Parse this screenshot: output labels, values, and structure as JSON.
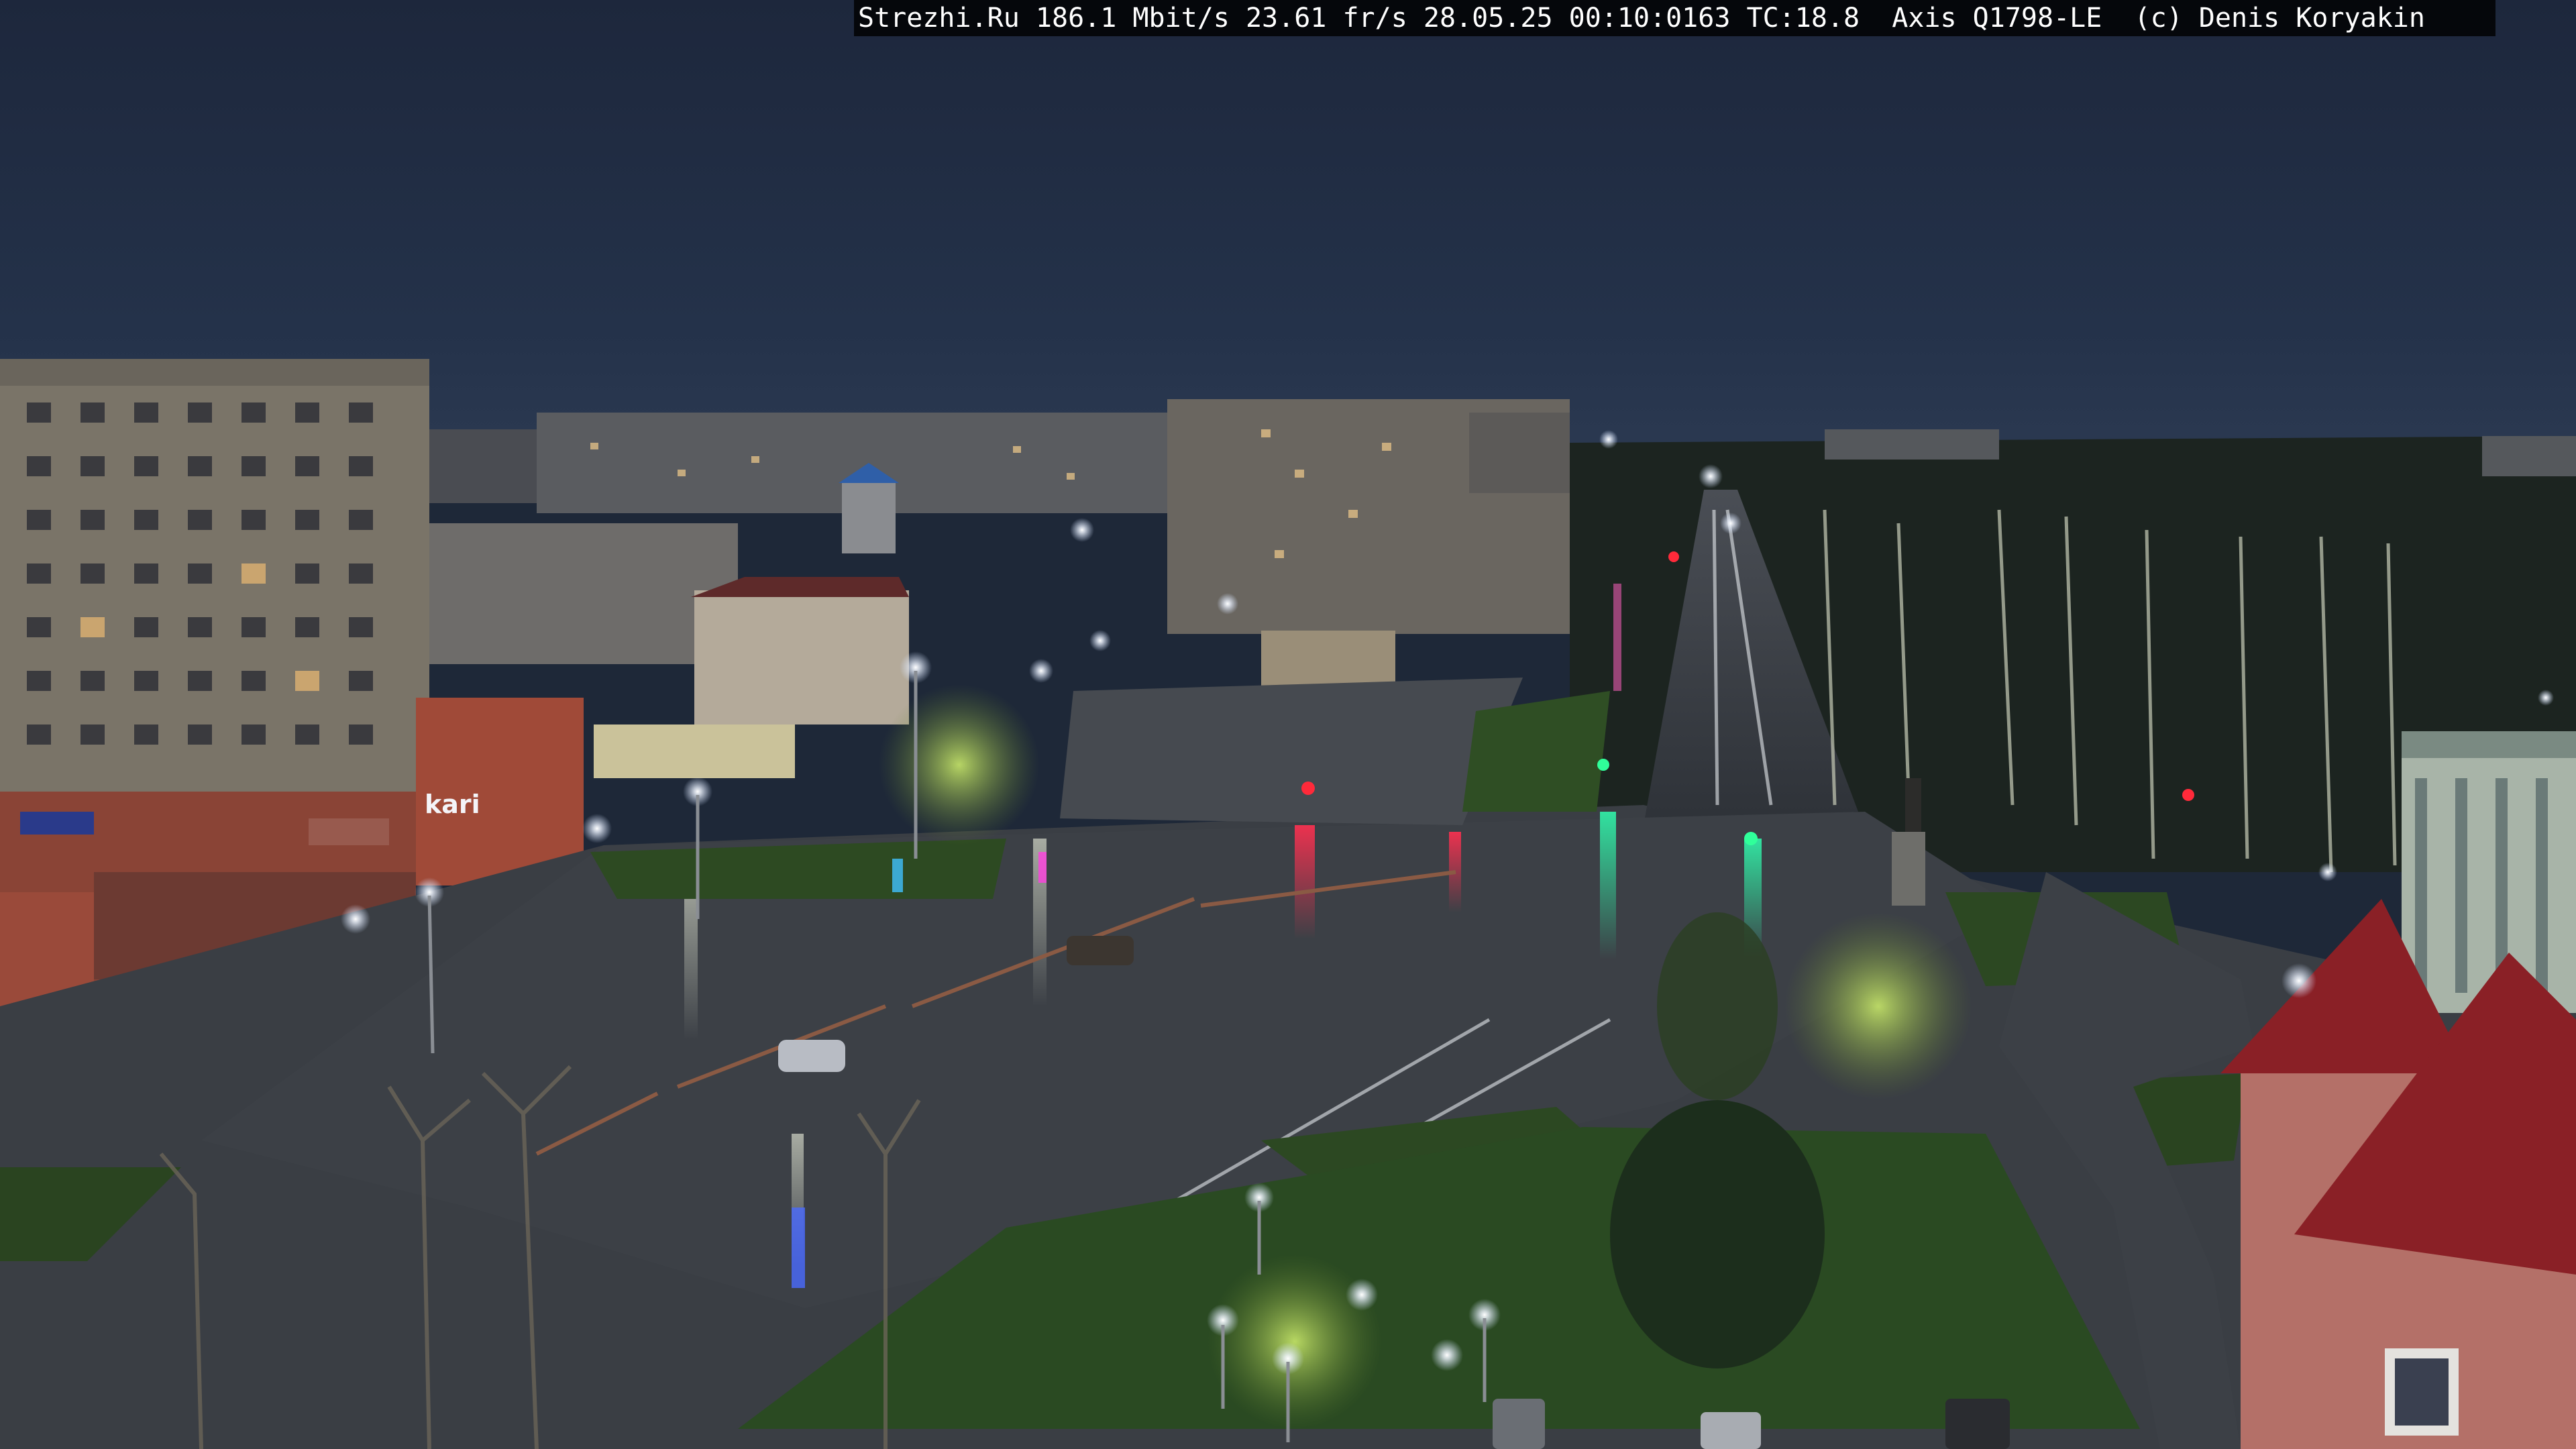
{
  "camera_overlay": {
    "text": "Strezhi.Ru 186.1 Mbit/s 23.61 fr/s 28.05.25 00:10:0163 TC:18.8  Axis Q1798-LE  (c) Denis Koryakin"
  },
  "storefront_signs": {
    "kari": "kari"
  },
  "colors": {
    "sky": "#1f2b42",
    "asphalt": "#35393f",
    "grass": "#2f4a25",
    "streetlight": "#f2f6ff"
  }
}
